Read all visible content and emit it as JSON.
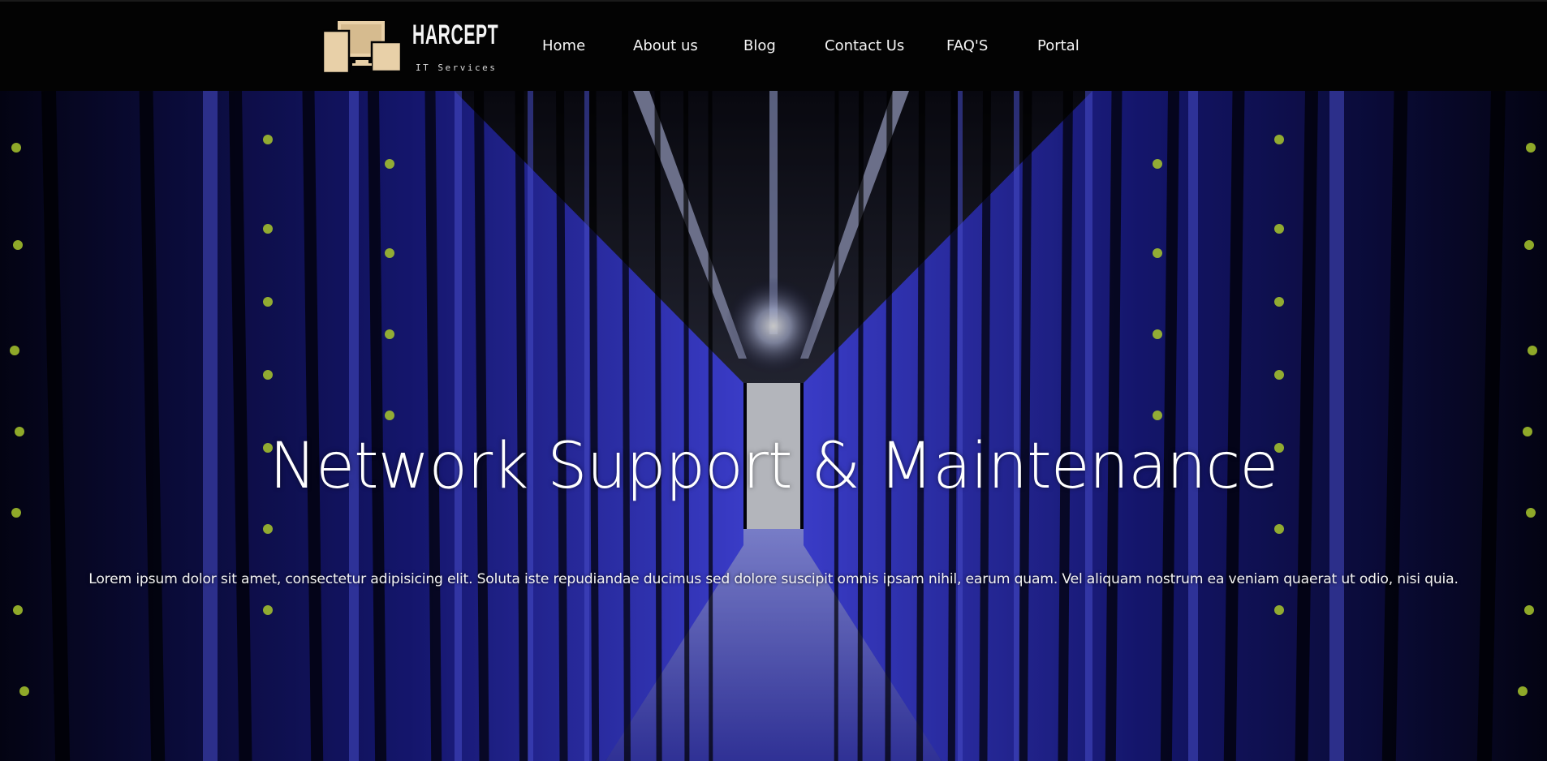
{
  "brand": {
    "name": "HARCEPT",
    "tagline": "IT Services",
    "logo_color": "#e8d0a8"
  },
  "nav": {
    "items": [
      {
        "label": "Home"
      },
      {
        "label": "About us"
      },
      {
        "label": "Blog"
      },
      {
        "label": "Contact Us"
      },
      {
        "label": "FAQ'S"
      },
      {
        "label": "Portal"
      }
    ]
  },
  "hero": {
    "title": "Network Support & Maintenance",
    "text": "Lorem ipsum dolor sit amet, consectetur adipisicing elit. Soluta iste repudiandae ducimus sed dolore suscipit omnis ipsam nihil, earum quam. Vel aliquam nostrum ea veniam quaerat ut odio, nisi quia.",
    "image": "server-room-corridor",
    "colors": {
      "accent": "#3b3bff",
      "led": "#d8ff3a"
    }
  }
}
